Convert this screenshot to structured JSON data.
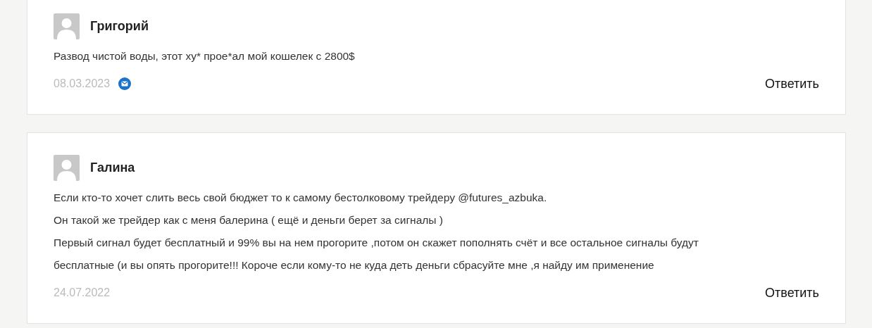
{
  "comments": [
    {
      "author": "Григорий",
      "lines": [
        "Развод чистой воды, этот ху* прое*ал мой кошелек с 2800$"
      ],
      "date": "08.03.2023",
      "email_badge": true,
      "reply": "Ответить"
    },
    {
      "author": "Галина",
      "lines": [
        "Если кто-то хочет слить весь свой бюджет то к самому бестолковому трейдеру @futures_azbuka.",
        "Он такой же трейдер как с меня балерина ( ещё и деньги берет за сигналы )",
        "Первый сигнал будет бесплатный и 99% вы на нем прогорите ,потом он скажет пополнять счёт и все остальное сигналы будут",
        "бесплатные (и вы опять прогорите!!! Короче если кому-то не куда деть деньги сбрасуйте мне ,я найду им применение"
      ],
      "date": "24.07.2022",
      "email_badge": false,
      "reply": "Ответить"
    }
  ]
}
